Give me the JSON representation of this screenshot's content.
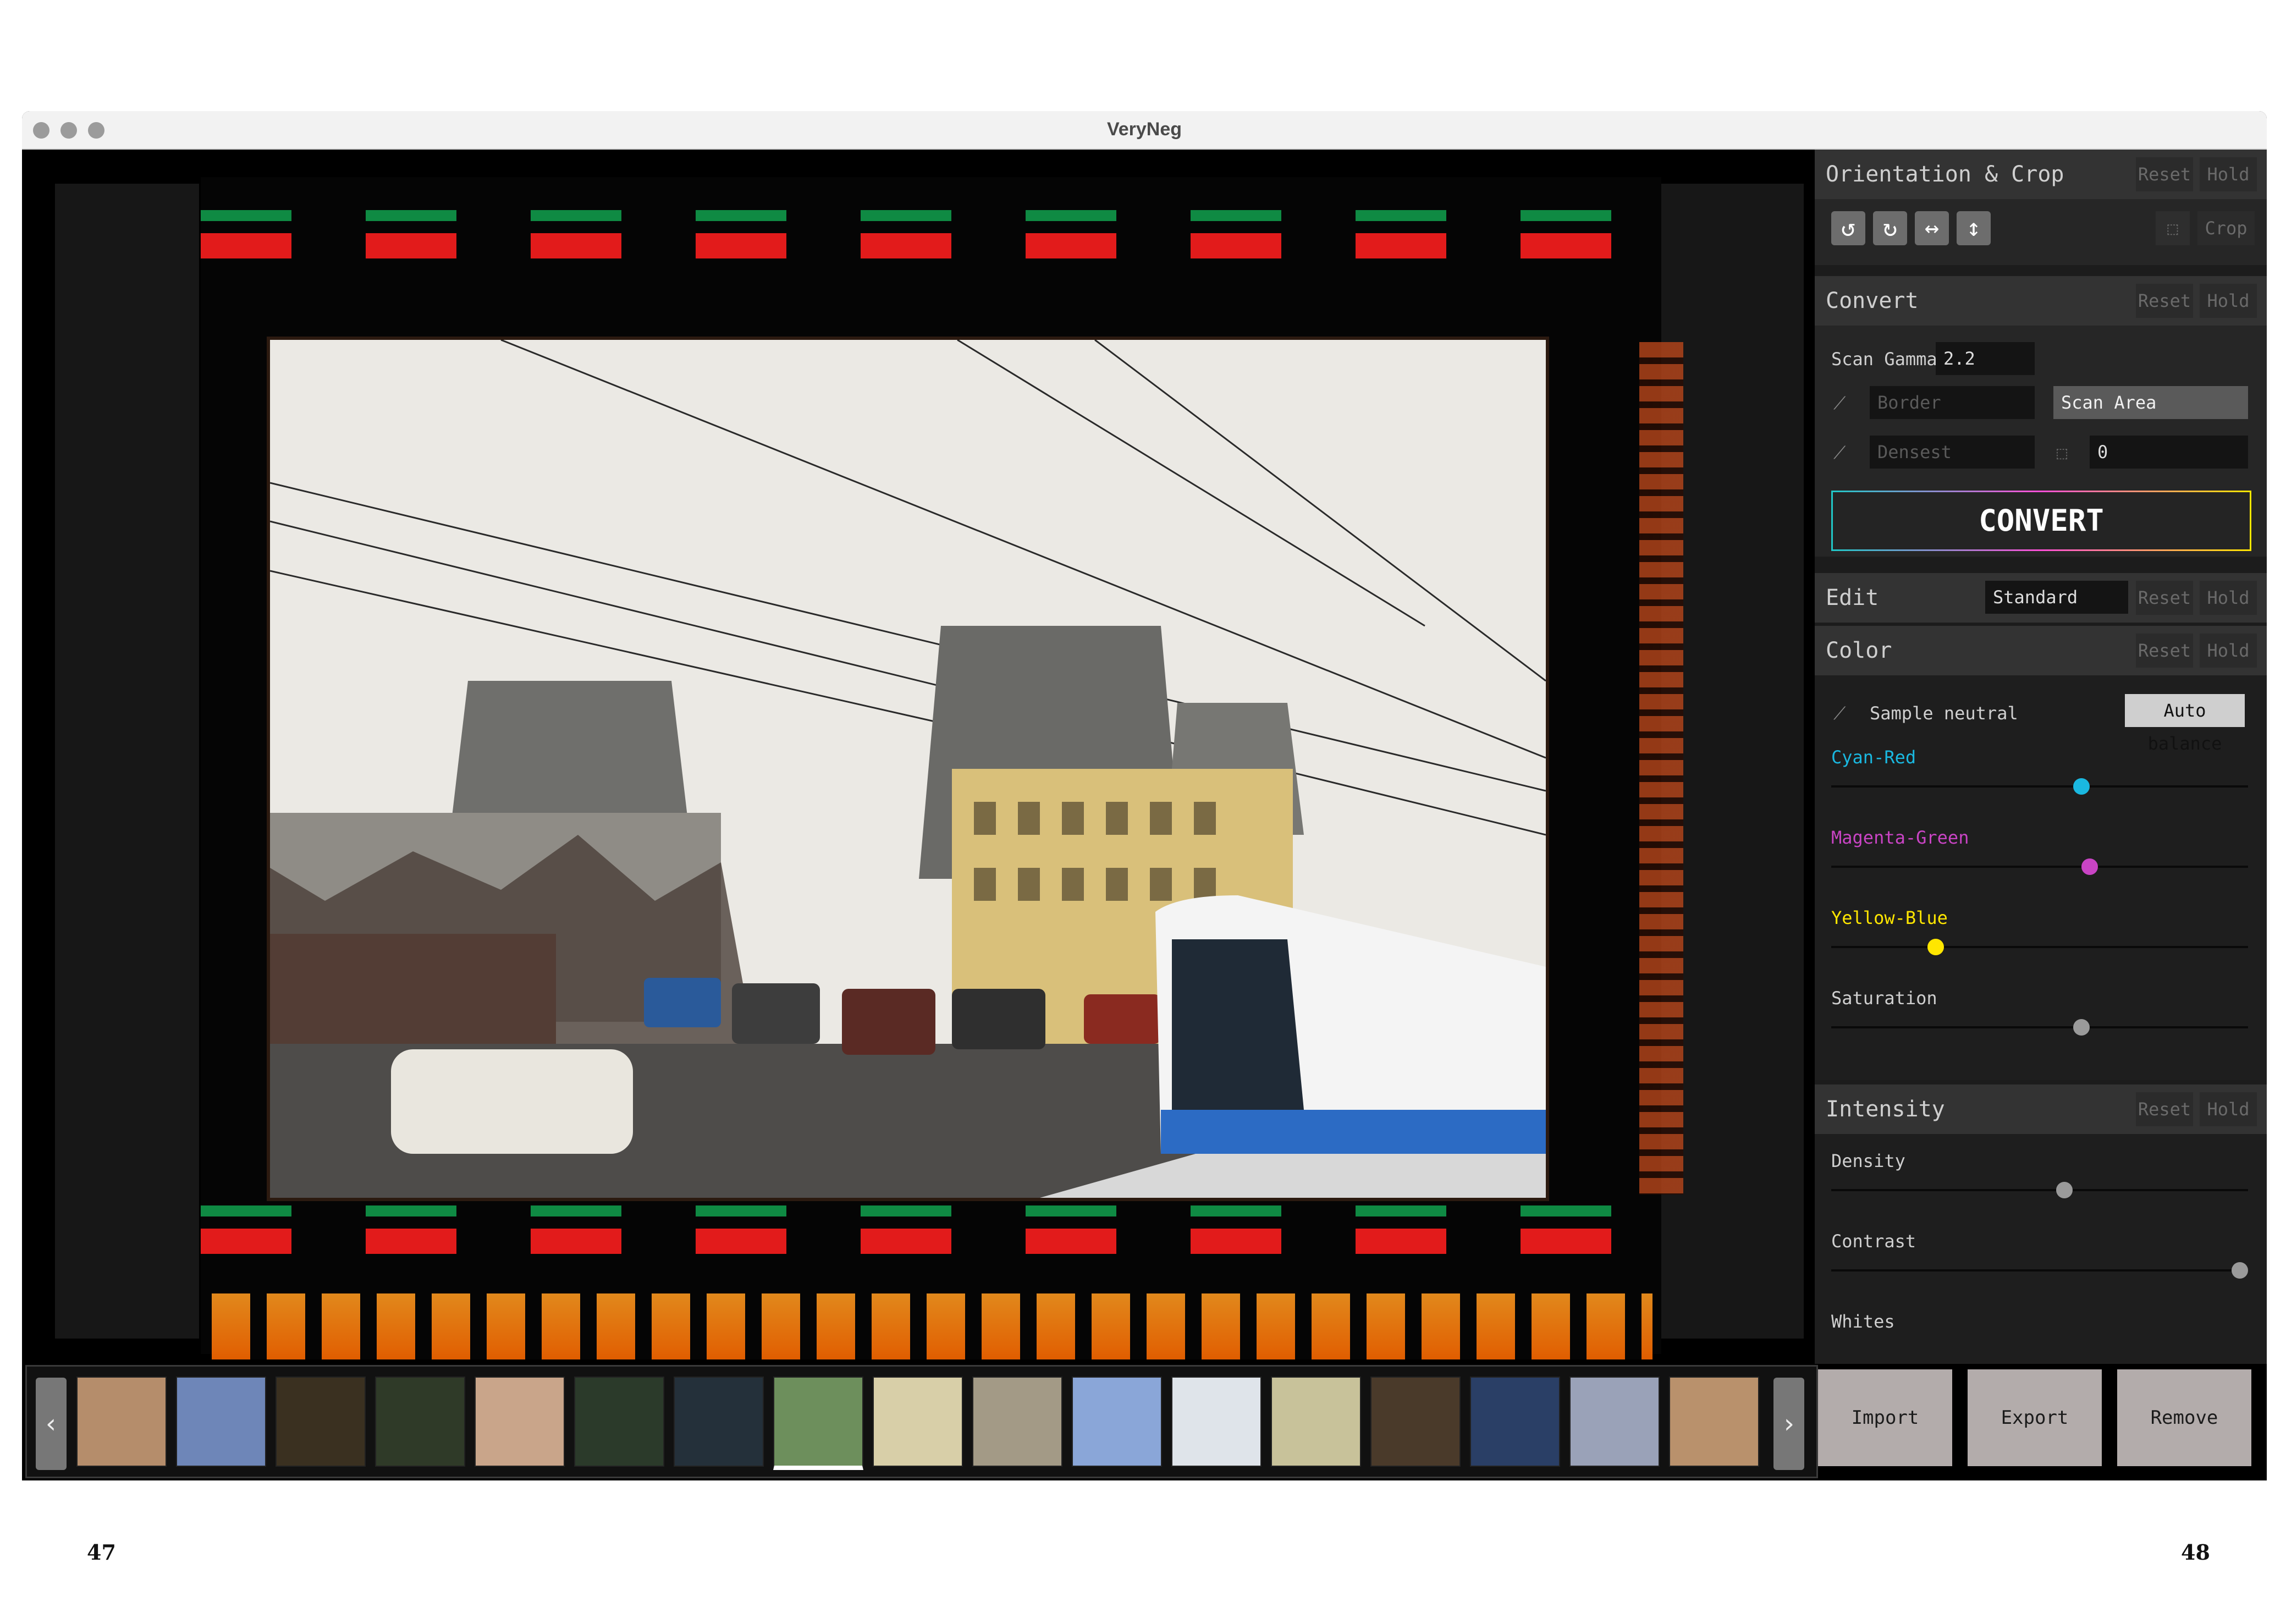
{
  "window": {
    "title": "VeryNeg"
  },
  "panel": {
    "orientation": {
      "title": "Orientation & Crop",
      "reset": "Reset",
      "hold": "Hold",
      "buttons": [
        {
          "name": "rotate-left-icon",
          "glyph": "↺"
        },
        {
          "name": "rotate-right-icon",
          "glyph": "↻"
        },
        {
          "name": "flip-horizontal-icon",
          "glyph": "↔"
        },
        {
          "name": "flip-vertical-icon",
          "glyph": "↕"
        }
      ],
      "crop": "Crop"
    },
    "convert": {
      "title": "Convert",
      "reset": "Reset",
      "hold": "Hold",
      "scan_gamma_label": "Scan Gamma",
      "scan_gamma_value": "2.2",
      "border_placeholder": "Border",
      "densest_placeholder": "Densest",
      "scan_area": "Scan Area",
      "scan_area_value": "0",
      "button": "CONVERT"
    },
    "edit": {
      "title": "Edit",
      "mode": "Standard",
      "reset": "Reset",
      "hold": "Hold"
    },
    "color": {
      "title": "Color",
      "reset": "Reset",
      "hold": "Hold",
      "sample_neutral": "Sample neutral",
      "auto_balance": "Auto balance",
      "sliders": [
        {
          "label": "Cyan-Red",
          "value": 0.6,
          "color": "#1ab8e0"
        },
        {
          "label": "Magenta-Green",
          "value": 0.62,
          "color": "#c944c4"
        },
        {
          "label": "Yellow-Blue",
          "value": 0.25,
          "color": "#ffe600"
        },
        {
          "label": "Saturation",
          "value": 0.6,
          "color": "#9a9a9a"
        }
      ]
    },
    "intensity": {
      "title": "Intensity",
      "reset": "Reset",
      "hold": "Hold",
      "sliders": [
        {
          "label": "Density",
          "value": 0.56,
          "color": "#9a9a9a"
        },
        {
          "label": "Contrast",
          "value": 0.98,
          "color": "#9a9a9a"
        },
        {
          "label": "Whites",
          "value": null,
          "color": "#9a9a9a"
        }
      ]
    }
  },
  "actions": {
    "import": "Import",
    "export": "Export",
    "remove": "Remove"
  },
  "filmstrip": {
    "prev": "‹",
    "next": "›",
    "thumb_colors": [
      "#b58d6b",
      "#6e86b8",
      "#3a3020",
      "#2f3a28",
      "#c9a58a",
      "#2b3a2a",
      "#24303a",
      "#6d8f5c",
      "#d8cfa8",
      "#a39a86",
      "#8aa6d8",
      "#dfe4ea",
      "#c8c29a",
      "#4a3a2a",
      "#2a3f66",
      "#9aa2b8",
      "#b9916c"
    ],
    "selected_index": 7
  },
  "pages": {
    "left": "47",
    "right": "48"
  }
}
